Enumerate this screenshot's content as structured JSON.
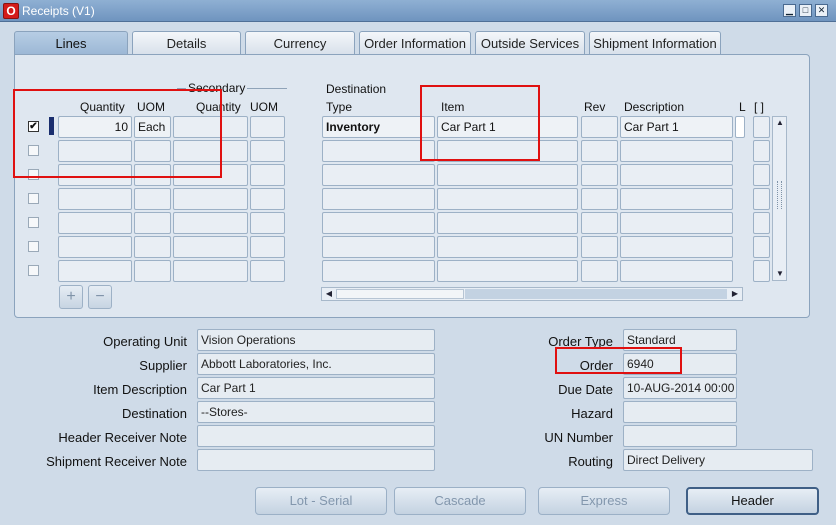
{
  "window": {
    "title": "Receipts (V1)",
    "min": "▁",
    "max": "□",
    "close": "✕"
  },
  "tabs": [
    {
      "label": "Lines"
    },
    {
      "label": "Details"
    },
    {
      "label": "Currency"
    },
    {
      "label": "Order Information"
    },
    {
      "label": "Outside Services"
    },
    {
      "label": "Shipment Information"
    }
  ],
  "grid": {
    "headers": {
      "secondary": "Secondary",
      "quantity": "Quantity",
      "uom": "UOM",
      "sec_quantity": "Quantity",
      "sec_uom": "UOM",
      "destination": "Destination",
      "type": "Type",
      "item": "Item",
      "rev": "Rev",
      "description": "Description",
      "l": "L",
      "bracket": "[ ]"
    },
    "row1": {
      "checked": "✔",
      "quantity": "10",
      "uom": "Each",
      "type": "Inventory",
      "item": "Car Part 1",
      "description": "Car Part 1"
    },
    "add_icon": "+",
    "remove_icon": "−"
  },
  "form": {
    "operating_unit_label": "Operating Unit",
    "operating_unit": "Vision Operations",
    "supplier_label": "Supplier",
    "supplier": "Abbott Laboratories, Inc.",
    "item_description_label": "Item Description",
    "item_description": "Car Part 1",
    "destination_label": "Destination",
    "destination": "--Stores-",
    "header_note_label": "Header Receiver Note",
    "header_note": "",
    "shipment_note_label": "Shipment Receiver Note",
    "shipment_note": "",
    "order_type_label": "Order Type",
    "order_type": "Standard",
    "order_label": "Order",
    "order": "6940",
    "due_date_label": "Due Date",
    "due_date": "10-AUG-2014 00:00",
    "hazard_label": "Hazard",
    "hazard": "",
    "un_number_label": "UN Number",
    "un_number": "",
    "routing_label": "Routing",
    "routing": "Direct Delivery"
  },
  "buttons": {
    "lot_serial": "Lot - Serial",
    "cascade": "Cascade",
    "express": "Express",
    "header": "Header"
  }
}
